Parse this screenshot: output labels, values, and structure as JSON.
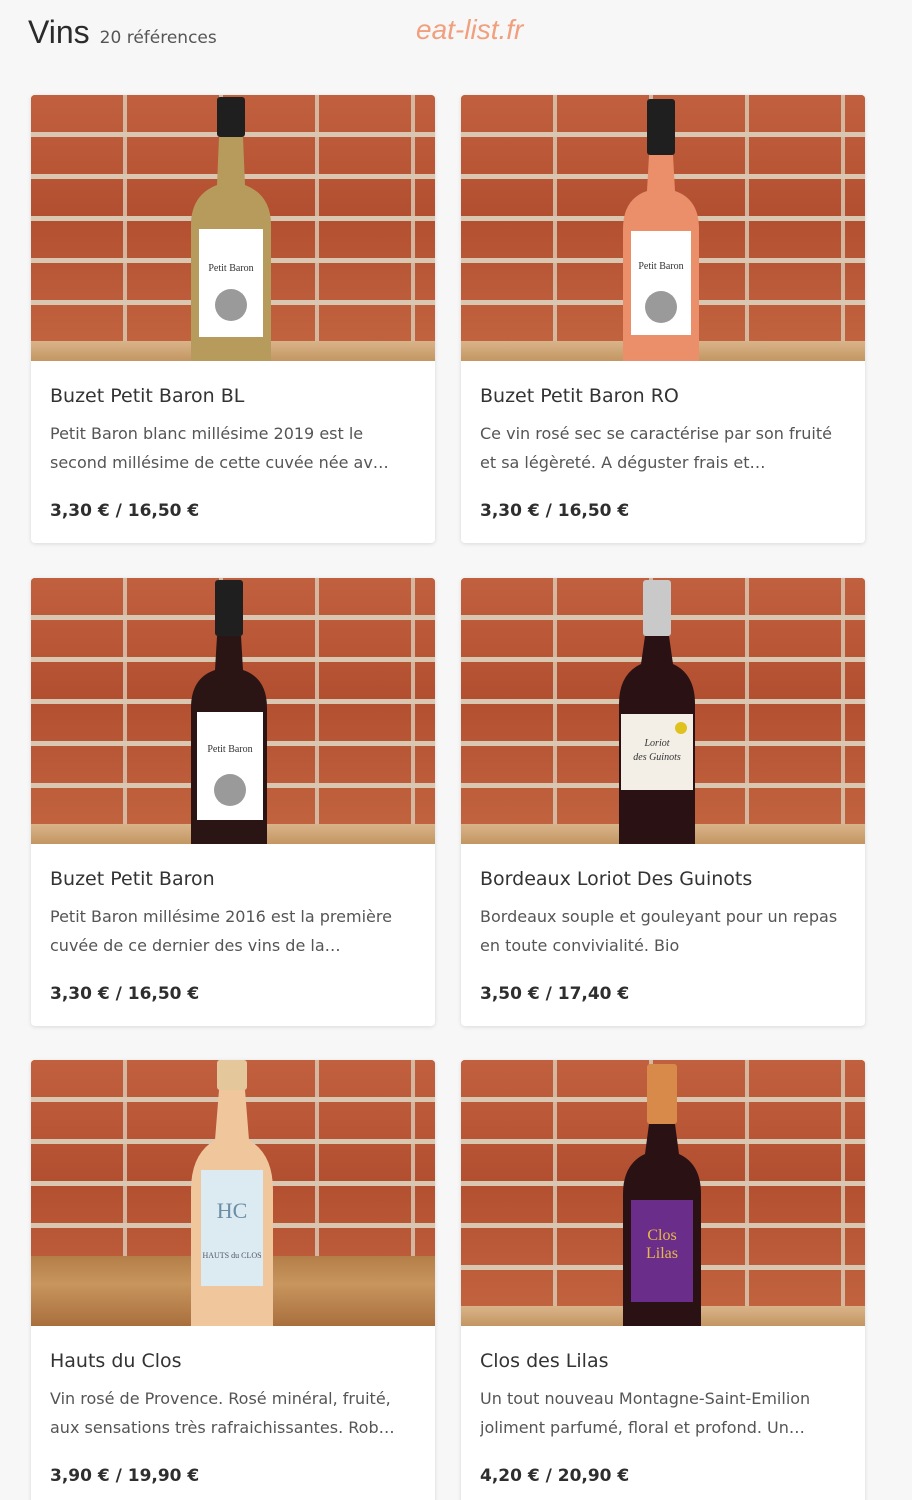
{
  "header": {
    "title": "Vins",
    "count": "20 références"
  },
  "watermark": "eat-list.fr",
  "products": [
    {
      "name": "Buzet Petit Baron BL",
      "desc": "Petit Baron blanc millésime 2019 est le second millésime de cette cuvée née av…",
      "price": "3,30 € / 16,50 €",
      "label": "Petit Baron",
      "wine_color": "#b79b5c",
      "label_color": "#ffffff"
    },
    {
      "name": "Buzet Petit Baron RO",
      "desc": "Ce vin rosé sec se caractérise par son fruité et sa légèreté. A déguster frais et…",
      "price": "3,30 € / 16,50 €",
      "label": "Petit Baron",
      "wine_color": "#ea8f6a",
      "label_color": "#ffffff"
    },
    {
      "name": "Buzet Petit Baron",
      "desc": "Petit Baron millésime 2016 est la première cuvée de ce dernier des vins de la…",
      "price": "3,30 € / 16,50 €",
      "label": "Petit Baron",
      "wine_color": "#2a1514",
      "label_color": "#ffffff"
    },
    {
      "name": "Bordeaux Loriot Des Guinots",
      "desc": "Bordeaux souple et gouleyant pour un repas en toute convivialité. Bio",
      "price": "3,50 € / 17,40 €",
      "label": "Loriot des Guinots",
      "wine_color": "#2a1214",
      "label_color": "#f3efe6"
    },
    {
      "name": "Hauts du Clos",
      "desc": "Vin rosé de Provence. Rosé minéral, fruité, aux sensations très rafraichissantes. Rob…",
      "price": "3,90 € / 19,90 €",
      "label": "Hauts du Clos",
      "wine_color": "#f0c79d",
      "label_color": "#dceaf2"
    },
    {
      "name": "Clos des Lilas",
      "desc": "Un tout nouveau Montagne-Saint-Emilion joliment parfumé, floral et profond. Un…",
      "price": "4,20 € / 20,90 €",
      "label": "Clos Lilas",
      "wine_color": "#2a1214",
      "label_color": "#6b2d8a"
    }
  ]
}
